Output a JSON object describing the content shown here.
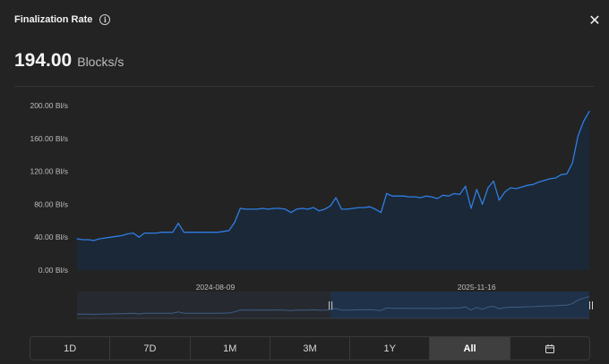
{
  "header": {
    "title": "Finalization Rate",
    "info_icon": "info-icon",
    "close_icon": "close-icon"
  },
  "metric": {
    "value": "194.00",
    "unit": "Blocks/s"
  },
  "colors": {
    "line": "#2f7de1",
    "fill": "#1b2838",
    "background": "#232323",
    "active_range": "#3f3f3f"
  },
  "ranges": [
    {
      "label": "1D",
      "active": false
    },
    {
      "label": "7D",
      "active": false
    },
    {
      "label": "1M",
      "active": false
    },
    {
      "label": "3M",
      "active": false
    },
    {
      "label": "1Y",
      "active": false
    },
    {
      "label": "All",
      "active": true
    },
    {
      "label": "",
      "icon": "calendar-icon",
      "active": false
    }
  ],
  "chart_data": {
    "type": "area",
    "title": "",
    "xlabel": "",
    "ylabel": "",
    "ylim": [
      0,
      200
    ],
    "y_ticks": [
      "0.00 Bl/s",
      "40.00 Bl/s",
      "80.00 Bl/s",
      "120.00 Bl/s",
      "160.00 Bl/s",
      "200.00 Bl/s"
    ],
    "x_ticks": [
      "2024-08-09",
      "2025-11-16"
    ],
    "grid": false,
    "series": [
      {
        "values": [
          38,
          37,
          37,
          36,
          38,
          39,
          40,
          41,
          42,
          44,
          45,
          40,
          45,
          45,
          45,
          46,
          46,
          46,
          57,
          46,
          46,
          46,
          46,
          46,
          46,
          46,
          47,
          48,
          58,
          75,
          74,
          74,
          74,
          75,
          74,
          75,
          75,
          74,
          70,
          74,
          75,
          74,
          76,
          72,
          74,
          78,
          88,
          74,
          74,
          75,
          76,
          76,
          77,
          74,
          70,
          93,
          90,
          90,
          90,
          89,
          89,
          88,
          90,
          89,
          87,
          91,
          90,
          93,
          92,
          102,
          75,
          98,
          80,
          100,
          108,
          85,
          95,
          100,
          99,
          101,
          103,
          104,
          107,
          109,
          111,
          112,
          116,
          117,
          130,
          163,
          181,
          193
        ]
      }
    ]
  }
}
